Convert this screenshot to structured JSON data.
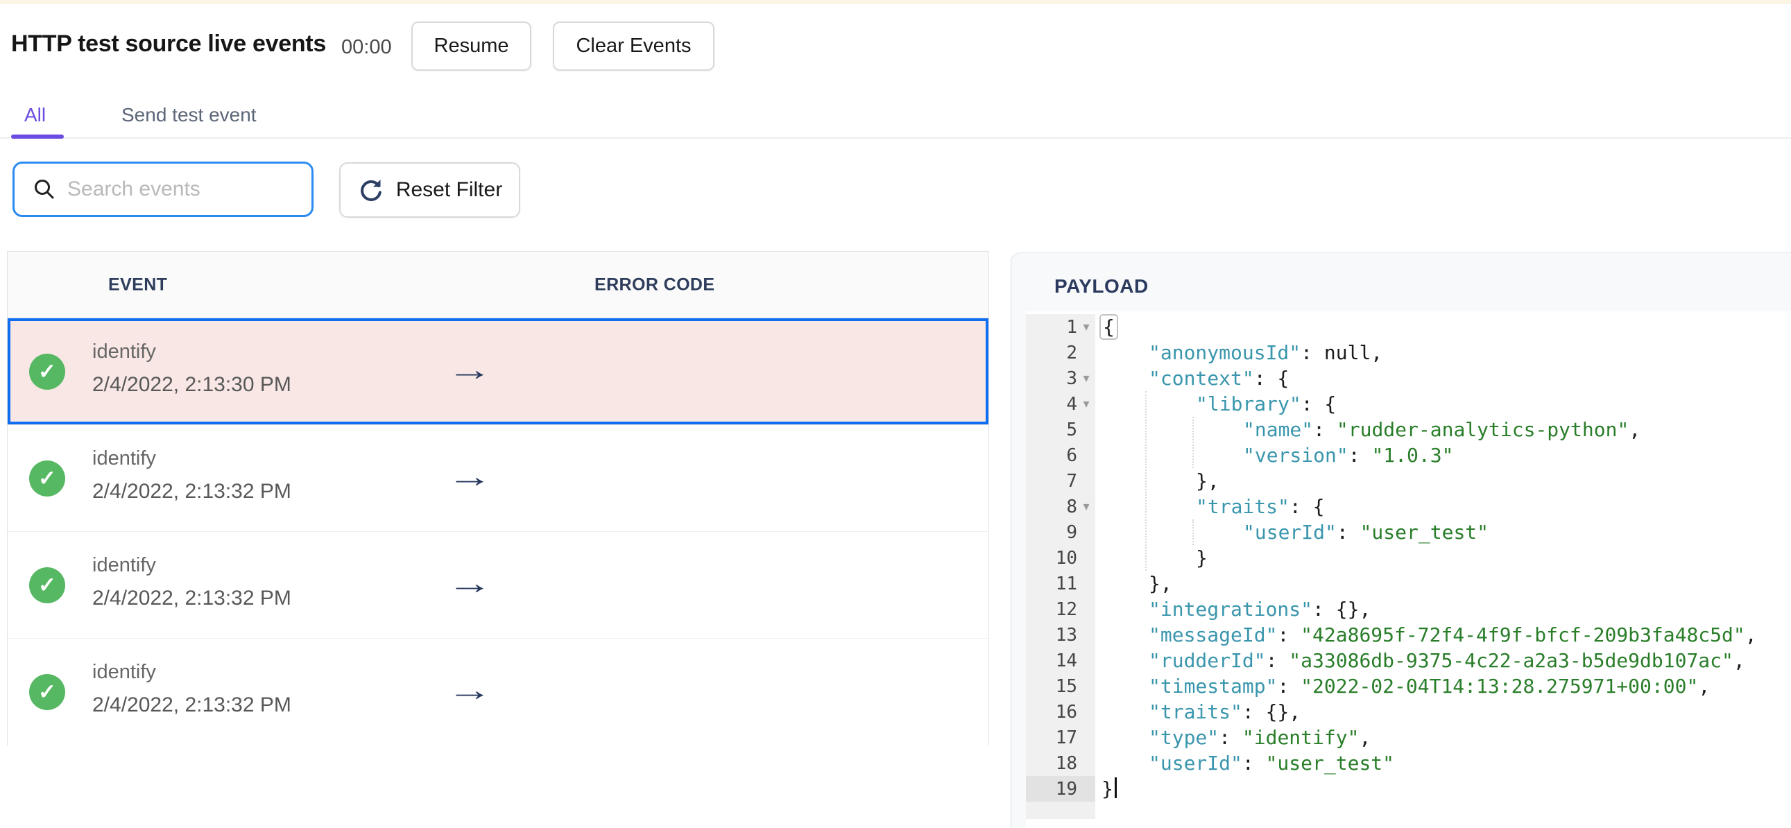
{
  "header": {
    "title": "HTTP test source live events",
    "timer": "00:00",
    "resume_label": "Resume",
    "clear_label": "Clear Events"
  },
  "tabs": [
    {
      "label": "All",
      "active": true
    },
    {
      "label": "Send test event",
      "active": false
    }
  ],
  "filter": {
    "search_placeholder": "Search events",
    "reset_label": "Reset Filter"
  },
  "table": {
    "columns": [
      "EVENT",
      "ERROR CODE"
    ],
    "rows": [
      {
        "event": "identify",
        "time": "2/4/2022, 2:13:30 PM",
        "status": "success",
        "arrow": "→",
        "selected": true
      },
      {
        "event": "identify",
        "time": "2/4/2022, 2:13:32 PM",
        "status": "success",
        "arrow": "→",
        "selected": false
      },
      {
        "event": "identify",
        "time": "2/4/2022, 2:13:32 PM",
        "status": "success",
        "arrow": "→",
        "selected": false
      },
      {
        "event": "identify",
        "time": "2/4/2022, 2:13:32 PM",
        "status": "success",
        "arrow": "→",
        "selected": false
      }
    ]
  },
  "payload": {
    "title": "PAYLOAD",
    "lines": [
      {
        "num": "1",
        "indent": 0,
        "fold": true,
        "active": false,
        "box": true,
        "cursor": false,
        "segments": [
          [
            "p",
            "{"
          ]
        ]
      },
      {
        "num": "2",
        "indent": 1,
        "fold": false,
        "active": false,
        "box": false,
        "cursor": false,
        "segments": [
          [
            "k",
            "\"anonymousId\""
          ],
          [
            "p",
            ": null,"
          ]
        ]
      },
      {
        "num": "3",
        "indent": 1,
        "fold": true,
        "active": false,
        "box": false,
        "cursor": false,
        "segments": [
          [
            "k",
            "\"context\""
          ],
          [
            "p",
            ": {"
          ]
        ]
      },
      {
        "num": "4",
        "indent": 2,
        "fold": true,
        "active": false,
        "box": false,
        "cursor": false,
        "segments": [
          [
            "k",
            "\"library\""
          ],
          [
            "p",
            ": {"
          ]
        ]
      },
      {
        "num": "5",
        "indent": 3,
        "fold": false,
        "active": false,
        "box": false,
        "cursor": false,
        "segments": [
          [
            "k",
            "\"name\""
          ],
          [
            "p",
            ": "
          ],
          [
            "s",
            "\"rudder-analytics-python\""
          ],
          [
            "p",
            ","
          ]
        ]
      },
      {
        "num": "6",
        "indent": 3,
        "fold": false,
        "active": false,
        "box": false,
        "cursor": false,
        "segments": [
          [
            "k",
            "\"version\""
          ],
          [
            "p",
            ": "
          ],
          [
            "s",
            "\"1.0.3\""
          ]
        ]
      },
      {
        "num": "7",
        "indent": 2,
        "fold": false,
        "active": false,
        "box": false,
        "cursor": false,
        "segments": [
          [
            "p",
            "},"
          ]
        ]
      },
      {
        "num": "8",
        "indent": 2,
        "fold": true,
        "active": false,
        "box": false,
        "cursor": false,
        "segments": [
          [
            "k",
            "\"traits\""
          ],
          [
            "p",
            ": {"
          ]
        ]
      },
      {
        "num": "9",
        "indent": 3,
        "fold": false,
        "active": false,
        "box": false,
        "cursor": false,
        "segments": [
          [
            "k",
            "\"userId\""
          ],
          [
            "p",
            ": "
          ],
          [
            "s",
            "\"user_test\""
          ]
        ]
      },
      {
        "num": "10",
        "indent": 2,
        "fold": false,
        "active": false,
        "box": false,
        "cursor": false,
        "segments": [
          [
            "p",
            "}"
          ]
        ]
      },
      {
        "num": "11",
        "indent": 1,
        "fold": false,
        "active": false,
        "box": false,
        "cursor": false,
        "segments": [
          [
            "p",
            "},"
          ]
        ]
      },
      {
        "num": "12",
        "indent": 1,
        "fold": false,
        "active": false,
        "box": false,
        "cursor": false,
        "segments": [
          [
            "k",
            "\"integrations\""
          ],
          [
            "p",
            ": {},"
          ]
        ]
      },
      {
        "num": "13",
        "indent": 1,
        "fold": false,
        "active": false,
        "box": false,
        "cursor": false,
        "segments": [
          [
            "k",
            "\"messageId\""
          ],
          [
            "p",
            ": "
          ],
          [
            "s",
            "\"42a8695f-72f4-4f9f-bfcf-209b3fa48c5d\""
          ],
          [
            "p",
            ","
          ]
        ]
      },
      {
        "num": "14",
        "indent": 1,
        "fold": false,
        "active": false,
        "box": false,
        "cursor": false,
        "segments": [
          [
            "k",
            "\"rudderId\""
          ],
          [
            "p",
            ": "
          ],
          [
            "s",
            "\"a33086db-9375-4c22-a2a3-b5de9db107ac\""
          ],
          [
            "p",
            ","
          ]
        ]
      },
      {
        "num": "15",
        "indent": 1,
        "fold": false,
        "active": false,
        "box": false,
        "cursor": false,
        "segments": [
          [
            "k",
            "\"timestamp\""
          ],
          [
            "p",
            ": "
          ],
          [
            "s",
            "\"2022-02-04T14:13:28.275971+00:00\""
          ],
          [
            "p",
            ","
          ]
        ]
      },
      {
        "num": "16",
        "indent": 1,
        "fold": false,
        "active": false,
        "box": false,
        "cursor": false,
        "segments": [
          [
            "k",
            "\"traits\""
          ],
          [
            "p",
            ": {},"
          ]
        ]
      },
      {
        "num": "17",
        "indent": 1,
        "fold": false,
        "active": false,
        "box": false,
        "cursor": false,
        "segments": [
          [
            "k",
            "\"type\""
          ],
          [
            "p",
            ": "
          ],
          [
            "s",
            "\"identify\""
          ],
          [
            "p",
            ","
          ]
        ]
      },
      {
        "num": "18",
        "indent": 1,
        "fold": false,
        "active": false,
        "box": false,
        "cursor": false,
        "segments": [
          [
            "k",
            "\"userId\""
          ],
          [
            "p",
            ": "
          ],
          [
            "s",
            "\"user_test\""
          ]
        ]
      },
      {
        "num": "19",
        "indent": 0,
        "fold": false,
        "active": true,
        "box": false,
        "cursor": true,
        "segments": [
          [
            "p",
            "}"
          ]
        ]
      }
    ]
  },
  "icons": {
    "status_check": "✓",
    "fold_arrow": "▾"
  },
  "colors": {
    "accent_purple": "#6b4be2",
    "selection_blue": "#0d6ef2",
    "selected_row_pink": "#f8e7e5",
    "success_green": "#57b863",
    "search_border_blue": "#2b8bf2",
    "json_key_teal": "#3a96ad",
    "json_string_green": "#2a7e2a",
    "top_bar_cream": "#fcf5e4"
  }
}
